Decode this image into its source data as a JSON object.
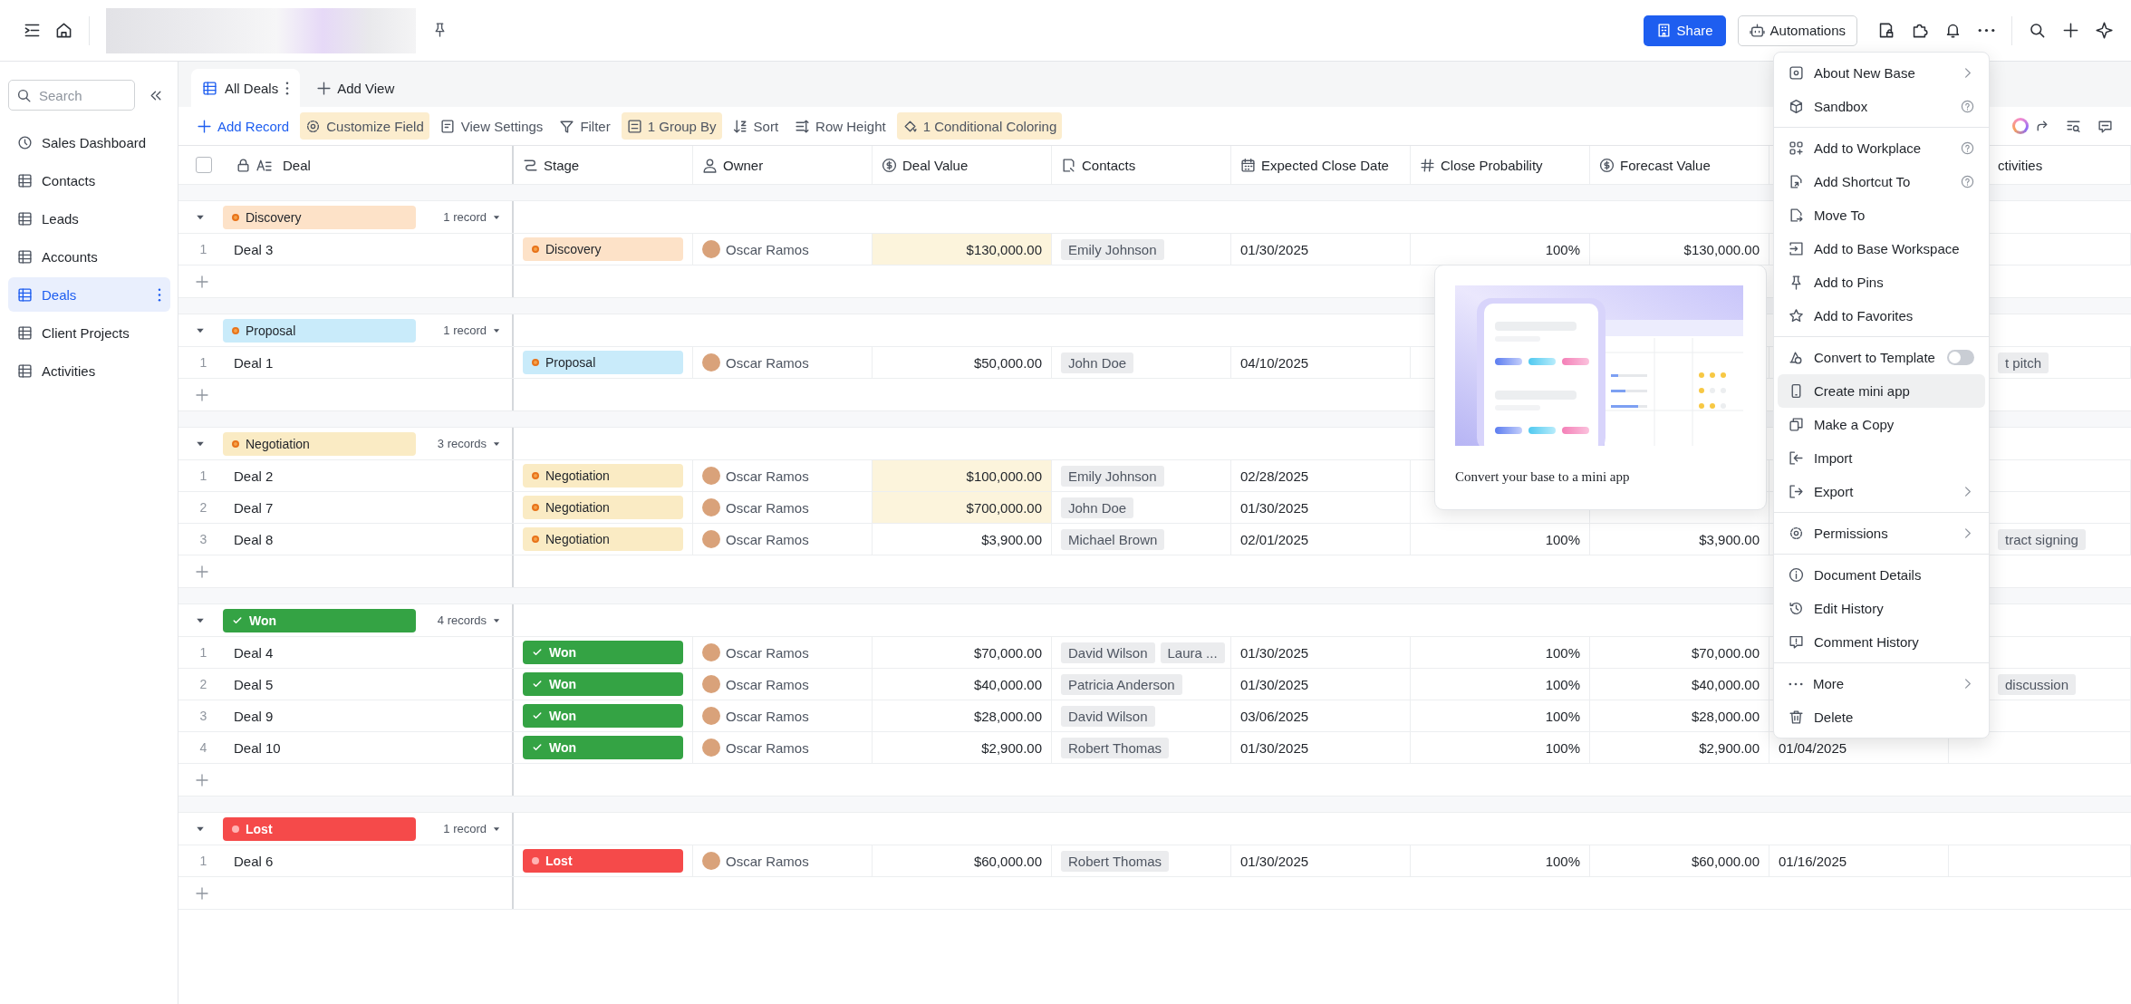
{
  "topbar": {
    "share": "Share",
    "automations": "Automations"
  },
  "sidebar": {
    "search_placeholder": "Search",
    "items": [
      {
        "label": "Sales Dashboard",
        "kind": "dashboard",
        "selected": false
      },
      {
        "label": "Contacts",
        "kind": "table",
        "selected": false
      },
      {
        "label": "Leads",
        "kind": "table",
        "selected": false
      },
      {
        "label": "Accounts",
        "kind": "table",
        "selected": false
      },
      {
        "label": "Deals",
        "kind": "table",
        "selected": true
      },
      {
        "label": "Client Projects",
        "kind": "table",
        "selected": false
      },
      {
        "label": "Activities",
        "kind": "table",
        "selected": false
      }
    ]
  },
  "tabs": [
    {
      "label": "All Deals",
      "selected": true
    }
  ],
  "add_view": "Add View",
  "toolbar": {
    "add_record": "Add Record",
    "items": [
      {
        "label": "Customize Field",
        "active": true
      },
      {
        "label": "View Settings",
        "active": false
      },
      {
        "label": "Filter",
        "active": false
      },
      {
        "label": "1 Group By",
        "active": true
      },
      {
        "label": "Sort",
        "active": false
      },
      {
        "label": "Row Height",
        "active": false
      },
      {
        "label": "1 Conditional Coloring",
        "active": true
      }
    ]
  },
  "table": {
    "select_all": {
      "checked": false
    },
    "columns": [
      {
        "label": "Deal"
      },
      {
        "label": "Stage"
      },
      {
        "label": "Owner"
      },
      {
        "label": "Deal Value"
      },
      {
        "label": "Contacts"
      },
      {
        "label": "Expected Close Date"
      },
      {
        "label": "Close Probability"
      },
      {
        "label": "Forecast Value"
      },
      {},
      {
        "label": "ctivities"
      }
    ],
    "groups": [
      {
        "tag": {
          "label": "Discovery",
          "color": "#fde2c8",
          "kind": "dot",
          "solid": false
        },
        "count": "1 record",
        "expanded": true,
        "rows": [
          {
            "number": "1",
            "deal": "Deal 3",
            "stage": "Discovery",
            "owner": "Oscar Ramos",
            "deal_value": "$130,000.00",
            "value_highlighted": true,
            "contacts": [
              "Emily Johnson"
            ],
            "expected_close_date": "01/30/2025",
            "close_probability": "100%",
            "forecast_value": "$130,000.00"
          }
        ]
      },
      {
        "tag": {
          "label": "Proposal",
          "color": "#c9ebfa",
          "kind": "dot",
          "solid": false
        },
        "count": "1 record",
        "expanded": true,
        "rows": [
          {
            "number": "1",
            "deal": "Deal 1",
            "stage": "Proposal",
            "owner": "Oscar Ramos",
            "deal_value": "$50,000.00",
            "value_highlighted": false,
            "contacts": [
              "John Doe"
            ],
            "expected_close_date": "04/10/2025",
            "activities": "t pitch"
          }
        ]
      },
      {
        "tag": {
          "label": "Negotiation",
          "color": "#faebc4",
          "kind": "dot",
          "solid": false
        },
        "count": "3 records",
        "expanded": true,
        "rows": [
          {
            "number": "1",
            "deal": "Deal 2",
            "stage": "Negotiation",
            "owner": "Oscar Ramos",
            "deal_value": "$100,000.00",
            "value_highlighted": true,
            "contacts": [
              "Emily Johnson"
            ],
            "expected_close_date": "02/28/2025"
          },
          {
            "number": "2",
            "deal": "Deal 7",
            "stage": "Negotiation",
            "owner": "Oscar Ramos",
            "deal_value": "$700,000.00",
            "value_highlighted": true,
            "contacts": [
              "John Doe"
            ],
            "expected_close_date": "01/30/2025"
          },
          {
            "number": "3",
            "deal": "Deal 8",
            "stage": "Negotiation",
            "owner": "Oscar Ramos",
            "deal_value": "$3,900.00",
            "value_highlighted": false,
            "contacts": [
              "Michael Brown"
            ],
            "expected_close_date": "02/01/2025",
            "close_probability": "100%",
            "forecast_value": "$3,900.00",
            "activities": "tract signing"
          }
        ]
      },
      {
        "tag": {
          "label": "Won",
          "color": "#34a344",
          "kind": "check",
          "solid": true
        },
        "count": "4 records",
        "expanded": true,
        "rows": [
          {
            "number": "1",
            "deal": "Deal 4",
            "stage": "Won",
            "owner": "Oscar Ramos",
            "deal_value": "$70,000.00",
            "value_highlighted": false,
            "contacts": [
              "David Wilson",
              "Laura ..."
            ],
            "expected_close_date": "01/30/2025",
            "close_probability": "100%",
            "forecast_value": "$70,000.00"
          },
          {
            "number": "2",
            "deal": "Deal 5",
            "stage": "Won",
            "owner": "Oscar Ramos",
            "deal_value": "$40,000.00",
            "value_highlighted": false,
            "contacts": [
              "Patricia Anderson"
            ],
            "expected_close_date": "01/30/2025",
            "close_probability": "100%",
            "forecast_value": "$40,000.00",
            "activities": "discussion"
          },
          {
            "number": "3",
            "deal": "Deal 9",
            "stage": "Won",
            "owner": "Oscar Ramos",
            "deal_value": "$28,000.00",
            "value_highlighted": false,
            "contacts": [
              "David Wilson"
            ],
            "expected_close_date": "03/06/2025",
            "close_probability": "100%",
            "forecast_value": "$28,000.00"
          },
          {
            "number": "4",
            "deal": "Deal 10",
            "stage": "Won",
            "owner": "Oscar Ramos",
            "deal_value": "$2,900.00",
            "value_highlighted": false,
            "contacts": [
              "Robert Thomas"
            ],
            "expected_close_date": "01/30/2025",
            "close_probability": "100%",
            "forecast_value": "$2,900.00",
            "column_9": "01/04/2025"
          }
        ]
      },
      {
        "tag": {
          "label": "Lost",
          "color": "#f54a4a",
          "kind": "dot",
          "solid": true
        },
        "count": "1 record",
        "expanded": true,
        "rows": [
          {
            "number": "1",
            "deal": "Deal 6",
            "stage": "Lost",
            "owner": "Oscar Ramos",
            "deal_value": "$60,000.00",
            "value_highlighted": false,
            "contacts": [
              "Robert Thomas"
            ],
            "expected_close_date": "01/30/2025",
            "close_probability": "100%",
            "forecast_value": "$60,000.00",
            "column_9": "01/16/2025"
          }
        ]
      }
    ]
  },
  "popover": {
    "caption": "Convert your base to a mini app"
  },
  "menu": {
    "sections": [
      [
        {
          "label": "About New Base",
          "kind": "submenu",
          "highlighted": false
        },
        {
          "label": "Sandbox",
          "kind": "help",
          "highlighted": false
        }
      ],
      [
        {
          "label": "Add to Workplace",
          "kind": "help",
          "highlighted": false
        },
        {
          "label": "Add Shortcut To",
          "kind": "help",
          "highlighted": false
        },
        {
          "label": "Move To",
          "kind": "plain",
          "highlighted": false
        },
        {
          "label": "Add to Base Workspace",
          "kind": "plain",
          "highlighted": false
        },
        {
          "label": "Add to Pins",
          "kind": "plain",
          "highlighted": false
        },
        {
          "label": "Add to Favorites",
          "kind": "plain",
          "highlighted": false
        }
      ],
      [
        {
          "label": "Convert to Template",
          "kind": "toggle",
          "on": false,
          "highlighted": false
        },
        {
          "label": "Create mini app",
          "kind": "plain",
          "highlighted": true
        },
        {
          "label": "Make a Copy",
          "kind": "plain",
          "highlighted": false
        },
        {
          "label": "Import",
          "kind": "plain",
          "highlighted": false
        },
        {
          "label": "Export",
          "kind": "submenu",
          "highlighted": false
        }
      ],
      [
        {
          "label": "Permissions",
          "kind": "submenu",
          "highlighted": false
        }
      ],
      [
        {
          "label": "Document Details",
          "kind": "plain",
          "highlighted": false
        },
        {
          "label": "Edit History",
          "kind": "plain",
          "highlighted": false
        },
        {
          "label": "Comment History",
          "kind": "plain",
          "highlighted": false
        }
      ],
      [
        {
          "label": "More",
          "kind": "submenu",
          "highlighted": false
        },
        {
          "label": "Delete",
          "kind": "plain",
          "highlighted": false
        }
      ]
    ]
  }
}
